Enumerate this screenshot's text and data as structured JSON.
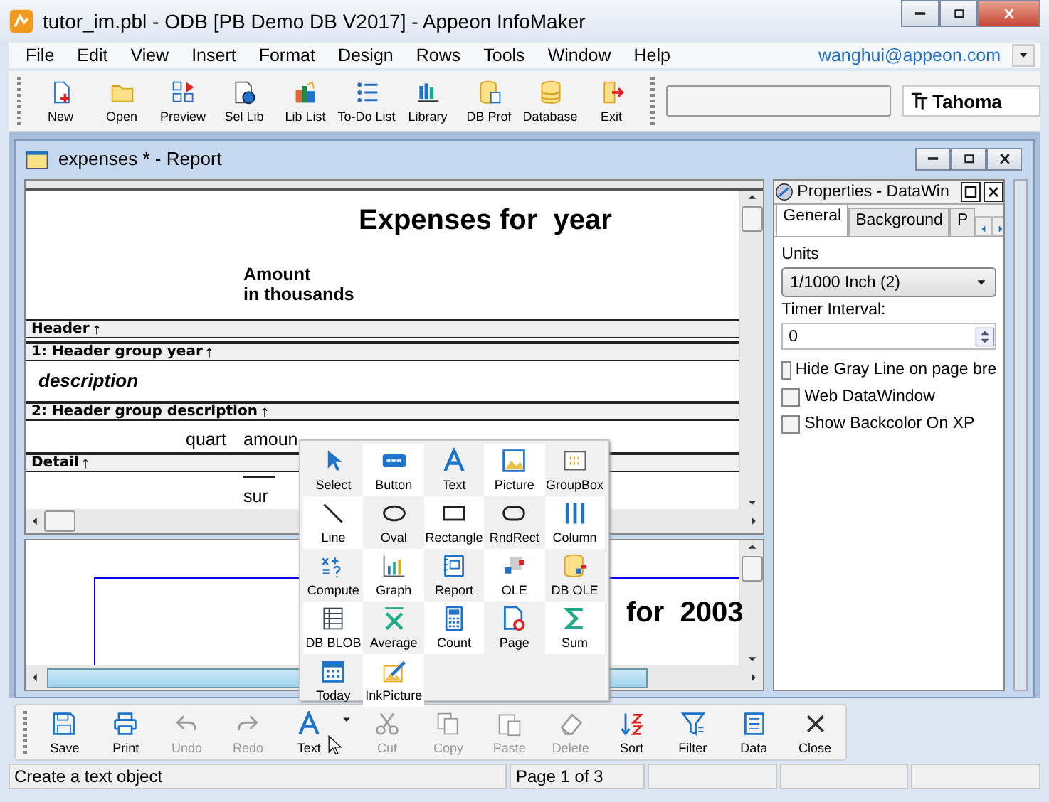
{
  "window": {
    "title": "tutor_im.pbl - ODB [PB Demo DB V2017]  - Appeon InfoMaker"
  },
  "menu": {
    "items": [
      "File",
      "Edit",
      "View",
      "Insert",
      "Format",
      "Design",
      "Rows",
      "Tools",
      "Window",
      "Help"
    ],
    "account": "wanghui@appeon.com"
  },
  "toolbar": {
    "buttons": [
      "New",
      "Open",
      "Preview",
      "Sel Lib",
      "Lib List",
      "To-Do List",
      "Library",
      "DB Prof",
      "Database",
      "Exit"
    ],
    "font_name": "Tahoma"
  },
  "report_window": {
    "title": "expenses * - Report",
    "design": [
      {
        "kind": "title",
        "text": "Expenses for  year"
      },
      {
        "kind": "heading",
        "lines": [
          "Amount",
          "in thousands"
        ]
      },
      {
        "kind": "band",
        "label": "Header"
      },
      {
        "kind": "band",
        "label": "1: Header group year"
      },
      {
        "kind": "group_field",
        "text": "description"
      },
      {
        "kind": "band",
        "label": "2: Header group description"
      },
      {
        "kind": "detail_fields",
        "cells": [
          "quart",
          "amoun"
        ]
      },
      {
        "kind": "band",
        "label": "Detail"
      },
      {
        "kind": "total",
        "text": "sur"
      }
    ],
    "preview": {
      "title": "for  2003"
    }
  },
  "properties": {
    "title": "Properties - DataWin",
    "tabs": [
      {
        "label": "General",
        "selected": true
      },
      {
        "label": "Background",
        "selected": false
      },
      {
        "label": "P",
        "selected": false
      }
    ],
    "units_label": "Units",
    "units_value": "1/1000 Inch (2)",
    "timer_label": "Timer Interval:",
    "timer_value": "0",
    "options": [
      {
        "label": "Hide Gray Line on page bre",
        "checked": false
      },
      {
        "label": "Web DataWindow",
        "checked": false
      },
      {
        "label": "Show Backcolor On XP",
        "checked": false
      }
    ]
  },
  "palette": {
    "tools": [
      "Select",
      "Button",
      "Text",
      "Picture",
      "GroupBox",
      "Line",
      "Oval",
      "Rectangle",
      "RndRect",
      "Column",
      "Compute",
      "Graph",
      "Report",
      "OLE",
      "DB OLE",
      "DB BLOB",
      "Average",
      "Count",
      "Page",
      "Sum",
      "Today",
      "InkPicture"
    ]
  },
  "bottom_toolbar": {
    "buttons": [
      {
        "label": "Save",
        "disabled": false,
        "has_menu": false
      },
      {
        "label": "Print",
        "disabled": false,
        "has_menu": false
      },
      {
        "label": "Undo",
        "disabled": true,
        "has_menu": false
      },
      {
        "label": "Redo",
        "disabled": true,
        "has_menu": false
      },
      {
        "label": "Text",
        "disabled": false,
        "has_menu": true
      },
      {
        "label": "Cut",
        "disabled": true,
        "has_menu": false
      },
      {
        "label": "Copy",
        "disabled": true,
        "has_menu": false
      },
      {
        "label": "Paste",
        "disabled": true,
        "has_menu": false
      },
      {
        "label": "Delete",
        "disabled": true,
        "has_menu": false
      },
      {
        "label": "Sort",
        "disabled": false,
        "has_menu": false
      },
      {
        "label": "Filter",
        "disabled": false,
        "has_menu": false
      },
      {
        "label": "Data",
        "disabled": false,
        "has_menu": false
      },
      {
        "label": "Close",
        "disabled": false,
        "has_menu": false
      }
    ]
  },
  "status_bar": {
    "message": "Create a text object",
    "page": "Page 1 of 3"
  }
}
